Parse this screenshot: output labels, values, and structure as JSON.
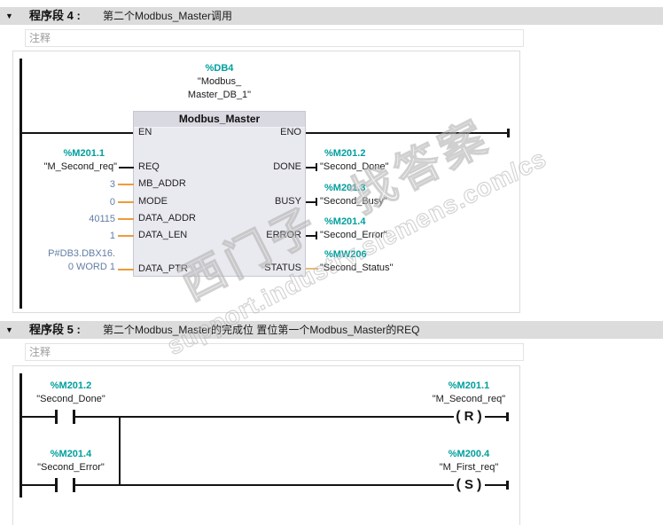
{
  "watermark": {
    "line1": "西门子 找答案",
    "line2": "support.industry.siemens.com/cs"
  },
  "network4": {
    "collapse_icon": "▼",
    "label": "程序段 4 :",
    "title": "第二个Modbus_Master调用",
    "comment": "注释",
    "block": {
      "db_address": "%DB4",
      "db_name_line1": "\"Modbus_",
      "db_name_line2": "Master_DB_1\"",
      "title": "Modbus_Master",
      "pins_left": [
        "EN",
        "REQ",
        "MB_ADDR",
        "MODE",
        "DATA_ADDR",
        "DATA_LEN",
        "DATA_PTR"
      ],
      "pins_right": [
        "ENO",
        "DONE",
        "BUSY",
        "ERROR",
        "STATUS"
      ]
    },
    "req_input": {
      "address": "%M201.1",
      "name": "\"M_Second_req\""
    },
    "mb_addr_value": "3",
    "mode_value": "0",
    "data_addr_value": "40115",
    "data_len_value": "1",
    "data_ptr_value_line1": "P#DB3.DBX16.",
    "data_ptr_value_line2": "0 WORD 1",
    "done_output": {
      "address": "%M201.2",
      "name": "\"Second_Done\""
    },
    "busy_output": {
      "address": "%M201.3",
      "name": "\"Second_Busy\""
    },
    "error_output": {
      "address": "%M201.4",
      "name": "\"Second_Error\""
    },
    "status_output": {
      "address": "%MW206",
      "name": "\"Second_Status\""
    }
  },
  "network5": {
    "collapse_icon": "▼",
    "label": "程序段 5 :",
    "title": "第二个Modbus_Master的完成位 置位第一个Modbus_Master的REQ",
    "comment": "注释",
    "contact1": {
      "address": "%M201.2",
      "name": "\"Second_Done\""
    },
    "contact2": {
      "address": "%M201.4",
      "name": "\"Second_Error\""
    },
    "coil1": {
      "address": "%M201.1",
      "name": "\"M_Second_req\"",
      "letter": "R"
    },
    "coil2": {
      "address": "%M200.4",
      "name": "\"M_First_req\"",
      "letter": "S"
    }
  },
  "colors": {
    "operand_teal": "#009e9e",
    "constant_blue": "#627ea6",
    "connector_orange": "#ed9b3c",
    "status_yellow": "#e4bd72",
    "network_bar_gray": "#dcdcdc",
    "block_body": "#e9e9f0",
    "block_header": "#d9d9e2"
  }
}
